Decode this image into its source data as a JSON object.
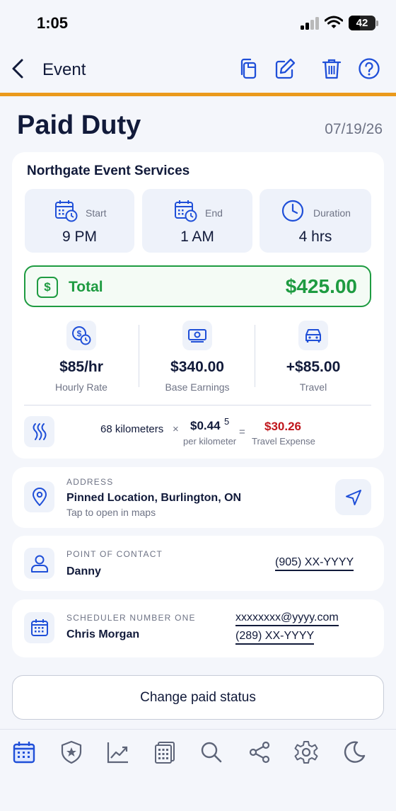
{
  "status_bar": {
    "time": "1:05",
    "battery": "42",
    "battery_level": 0.42
  },
  "nav": {
    "title": "Event",
    "icons": [
      "back-icon",
      "copy-icon",
      "edit-icon",
      "trash-icon",
      "help-icon"
    ]
  },
  "header": {
    "title": "Paid Duty",
    "date": "07/19/26"
  },
  "event": {
    "company": "Northgate Event Services",
    "start": {
      "label": "Start",
      "value": "9 PM"
    },
    "end": {
      "label": "End",
      "value": "1 AM"
    },
    "duration": {
      "label": "Duration",
      "value": "4 hrs"
    },
    "total": {
      "label": "Total",
      "value": "$425.00",
      "icon": "$"
    },
    "stats": {
      "hourly": {
        "value": "$85/hr",
        "label": "Hourly Rate"
      },
      "base": {
        "value": "$340.00",
        "label": "Base Earnings"
      },
      "travel": {
        "value": "+$85.00",
        "label": "Travel"
      }
    },
    "travel_calc": {
      "distance": "68 kilometers",
      "times": "×",
      "rate": "$0.44",
      "rate_sup": "5",
      "rate_unit": "per kilometer",
      "equals": "=",
      "expense": "$30.26",
      "expense_label": "Travel Expense"
    }
  },
  "address": {
    "label": "ADDRESS",
    "value": "Pinned Location, Burlington, ON",
    "hint": "Tap to open in maps"
  },
  "contact": {
    "label": "POINT OF CONTACT",
    "name": "Danny",
    "phone": "(905) XX-YYYY"
  },
  "scheduler": {
    "label": "SCHEDULER NUMBER ONE",
    "name": "Chris Morgan",
    "email": "xxxxxxxx@yyyy.com",
    "phone": "(289) XX-YYYY"
  },
  "actions": {
    "change_paid_status": "Change paid status"
  },
  "tab_bar": {
    "icons": [
      "calendar-icon",
      "badge-icon",
      "chart-icon",
      "calculator-icon",
      "search-icon",
      "share-icon",
      "settings-icon",
      "moon-icon"
    ]
  },
  "colors": {
    "accent": "#1f4fd8",
    "divider": "#ea9a1c",
    "success": "#1e9b41",
    "danger": "#c0161c",
    "text": "#111a3a"
  }
}
